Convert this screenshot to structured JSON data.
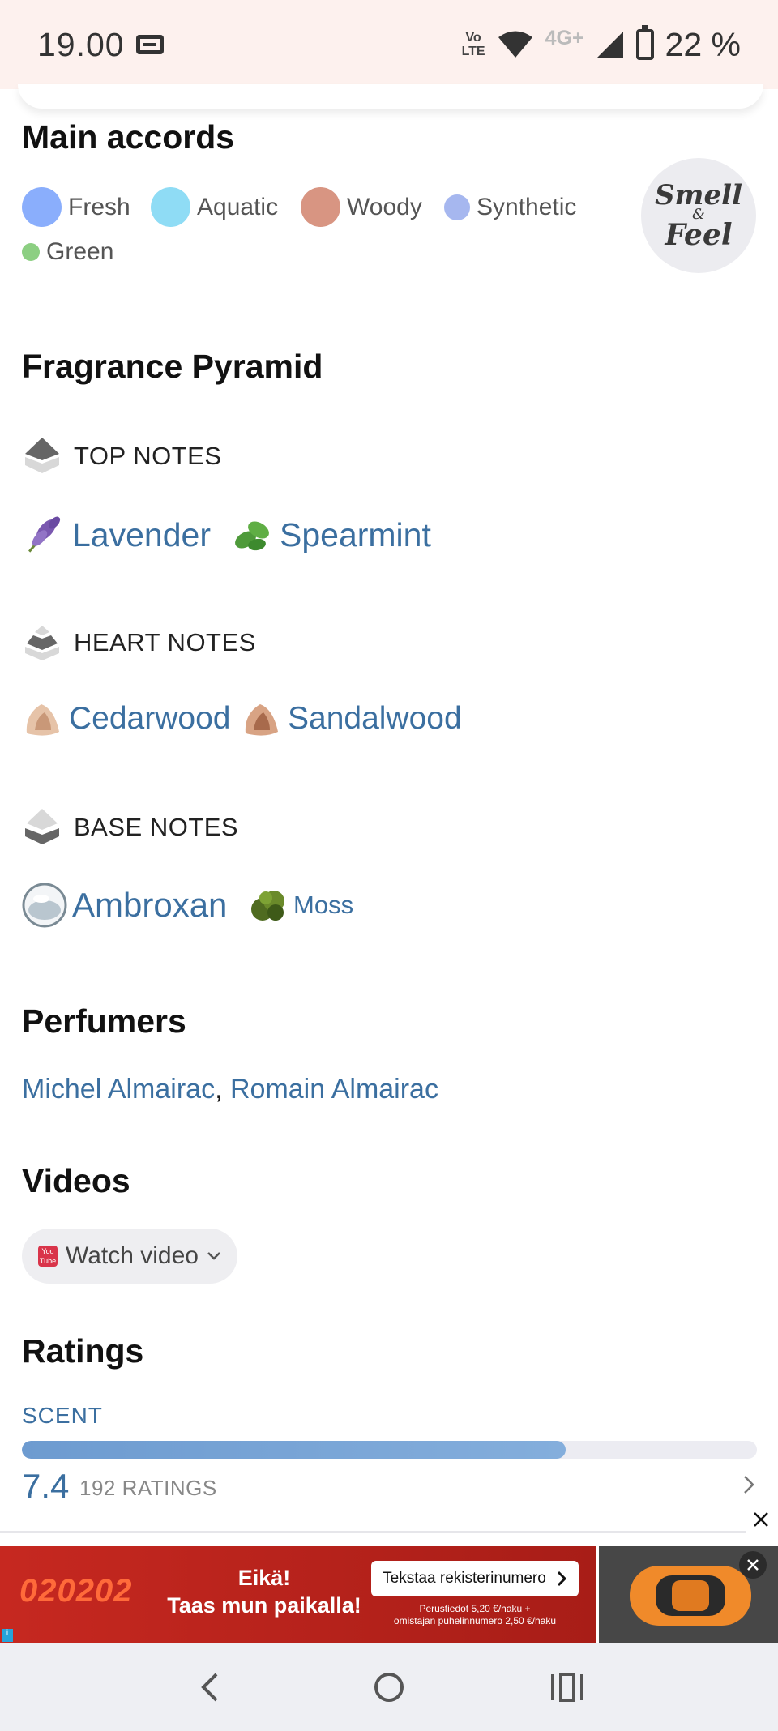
{
  "status_bar": {
    "time": "19.00",
    "volte_top": "Vo",
    "volte_bottom": "LTE",
    "network_type": "4G+",
    "battery": "22 %"
  },
  "main_accords": {
    "title": "Main accords",
    "items": [
      {
        "label": "Fresh",
        "color": "#8aaefc"
      },
      {
        "label": "Aquatic",
        "color": "#8fdcf5"
      },
      {
        "label": "Woody",
        "color": "#d89582"
      },
      {
        "label": "Synthetic",
        "color": "#a6b7ef"
      },
      {
        "label": "Green",
        "color": "#8ccf82"
      }
    ],
    "badge_line1": "Smell",
    "badge_amp": "&",
    "badge_line2": "Feel"
  },
  "pyramid": {
    "title": "Fragrance Pyramid",
    "top": {
      "heading": "TOP NOTES",
      "notes": [
        {
          "label": "Lavender",
          "icon": "lavender-icon"
        },
        {
          "label": "Spearmint",
          "icon": "spearmint-icon"
        }
      ]
    },
    "heart": {
      "heading": "HEART NOTES",
      "notes": [
        {
          "label": "Cedarwood",
          "icon": "cedarwood-icon"
        },
        {
          "label": "Sandalwood",
          "icon": "sandalwood-icon"
        }
      ]
    },
    "base": {
      "heading": "BASE NOTES",
      "notes": [
        {
          "label": "Ambroxan",
          "icon": "ambroxan-icon"
        },
        {
          "label": "Moss",
          "icon": "moss-icon"
        }
      ]
    }
  },
  "perfumers": {
    "title": "Perfumers",
    "names": [
      "Michel Almairac",
      "Romain Almairac"
    ],
    "separator": ","
  },
  "videos": {
    "title": "Videos",
    "button_label": "Watch video",
    "yt_line1": "You",
    "yt_line2": "Tube"
  },
  "ratings": {
    "title": "Ratings",
    "scent_label": "SCENT",
    "scent_value": "7.4",
    "scent_fraction": 0.74,
    "scent_count": "192 RATINGS"
  },
  "ad": {
    "number": "020202",
    "slogan_line1": "Eikä!",
    "slogan_line2": "Taas mun paikalla!",
    "cta": "Tekstaa rekisterinumero",
    "fine_line1": "Perustiedot 5,20 €/haku +",
    "fine_line2": "omistajan puhelinnumero 2,50 €/haku"
  }
}
